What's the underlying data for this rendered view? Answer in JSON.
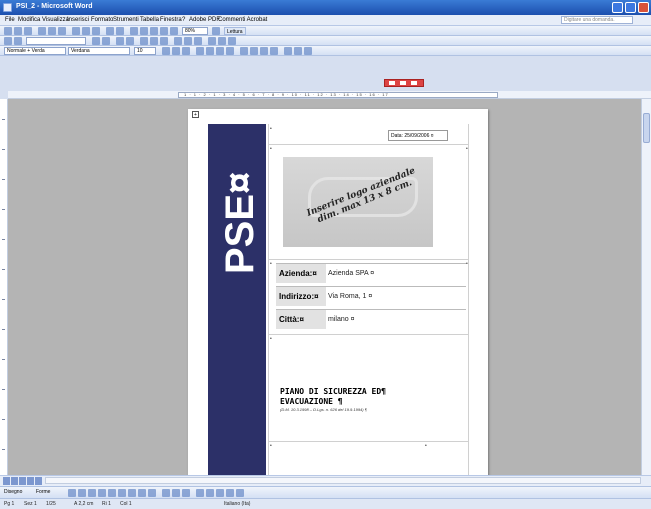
{
  "window": {
    "title": "PSI_2 - Microsoft Word"
  },
  "menu": {
    "items": [
      "File",
      "Modifica",
      "Visualizza",
      "Inserisci",
      "Formato",
      "Strumenti",
      "Tabella",
      "Finestra",
      "?",
      "Adobe PDF",
      "Commenti Acrobat"
    ],
    "help_placeholder": "Digitare una domanda."
  },
  "toolbar": {
    "zoom": "80%",
    "read_button": "Lettura",
    "style": "Normale + Verda",
    "font": "Verdana",
    "font_size": "10"
  },
  "document": {
    "date_cell": "Data: 25/09/2006 ¤",
    "side_title": "PSE¤",
    "logo_text_line1": "Inserire logo aziendale",
    "logo_text_line2": "dim. max 13 x 8 cm.",
    "rows": [
      {
        "label": "Azienda:¤",
        "value": "Azienda SPA ¤"
      },
      {
        "label": "Indirizzo:¤",
        "value": "Via Roma, 1 ¤"
      },
      {
        "label": "Città:¤",
        "value": "milano ¤"
      }
    ],
    "title_line1": "PIANO DI SICUREZZA ED¶",
    "title_line2": "EVACUAZIONE ¶",
    "subtitle": "(D.M. 10.3.1998 – D.Lgs. n. 626 del 19.9.1994) ¶"
  },
  "drawing_bar": {
    "draw_label": "Disegno",
    "shapes_label": "Forme"
  },
  "status": {
    "pg": "Pg 1",
    "sez": "Sez 1",
    "pages": "1/25",
    "pos": "A 2,2 cm",
    "ri": "Ri 1",
    "col": "Col 1",
    "lang": "Italiano (Ita)"
  }
}
